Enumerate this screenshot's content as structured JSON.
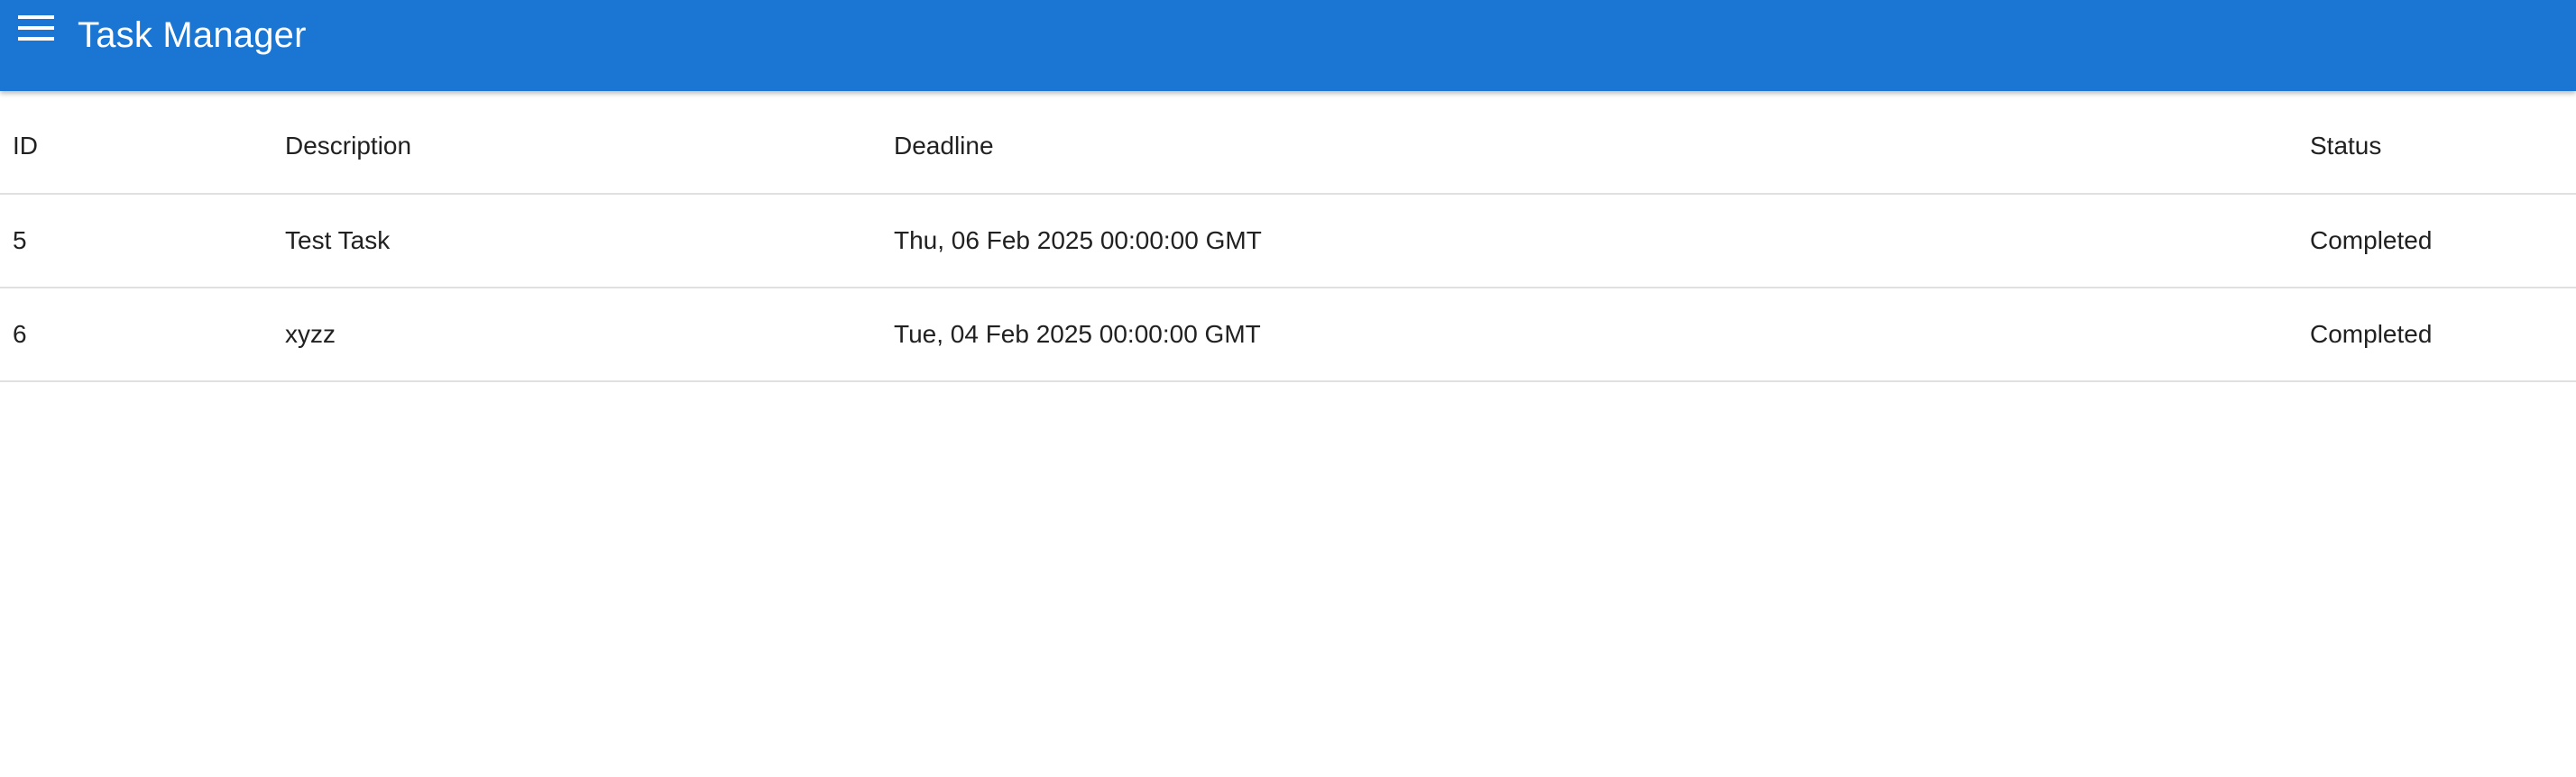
{
  "app": {
    "title": "Task Manager",
    "menu_icon": "menu-icon",
    "primary_color": "#1a76d2"
  },
  "table": {
    "columns": [
      "ID",
      "Description",
      "Deadline",
      "Status"
    ],
    "rows": [
      {
        "id": "5",
        "description": "Test Task",
        "deadline": "Thu, 06 Feb 2025 00:00:00 GMT",
        "status": "Completed"
      },
      {
        "id": "6",
        "description": "xyzz",
        "deadline": "Tue, 04 Feb 2025 00:00:00 GMT",
        "status": "Completed"
      }
    ]
  }
}
